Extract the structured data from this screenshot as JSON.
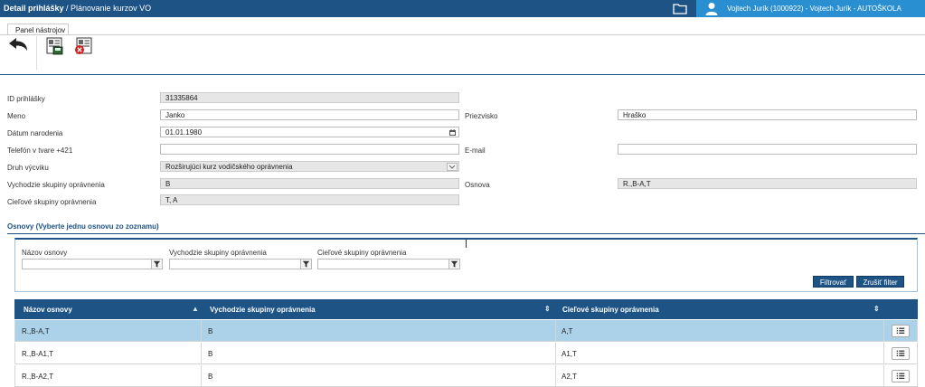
{
  "header": {
    "title": "Detail prihlášky",
    "breadcrumb": " / Plánovanie kurzov VO",
    "user": "Vojtech Jurík (1000922) - Vojtech Jurík - AUTOŠKOLA"
  },
  "toolbar": {
    "tab_label": "Panel nástrojov"
  },
  "form": {
    "id_label": "ID prihlášky",
    "id_value": "31335864",
    "meno_label": "Meno",
    "meno_value": "Janko",
    "priezvisko_label": "Priezvisko",
    "priezvisko_value": "Hraško",
    "datum_label": "Dátum narodenia",
    "datum_value": "01.01.1980",
    "telefon_label": "Telefón v tvare +421",
    "telefon_value": "",
    "email_label": "E-mail",
    "email_value": "",
    "druh_label": "Druh výcviku",
    "druh_value": "Rozširujúci kurz vodičského oprávnenia",
    "vychodzie_label": "Vychodzie skupiny oprávnenia",
    "vychodzie_value": "B",
    "osnova_label": "Osnova",
    "osnova_value": "R.,B-A,T",
    "cielove_label": "Cieľové skupiny oprávnenia",
    "cielove_value": "T, A"
  },
  "osnovy": {
    "section_title": "Osnovy (Vyberte jednu osnovu zo zoznamu)",
    "filter_nazov_label": "Názov osnovy",
    "filter_vychodzie_label": "Vychodzie skupiny oprávnenia",
    "filter_cielove_label": "Cieľové skupiny oprávnenia",
    "filter_button": "Filtrovať",
    "reset_button": "Zrušiť filter",
    "columns": [
      "Názov osnovy",
      "Vychodzie skupiny oprávnenia",
      "Cieľové skupiny oprávnenia"
    ],
    "rows": [
      {
        "nazov": "R.,B-A,T",
        "vychodzie": "B",
        "cielove": "A,T"
      },
      {
        "nazov": "R.,B-A1,T",
        "vychodzie": "B",
        "cielove": "A1,T"
      },
      {
        "nazov": "R.,B-A2,T",
        "vychodzie": "B",
        "cielove": "A2,T"
      }
    ]
  },
  "colors": {
    "header_bg": "#1d5385",
    "user_bg": "#2a8fd1",
    "selected_row": "#acd2e9"
  }
}
